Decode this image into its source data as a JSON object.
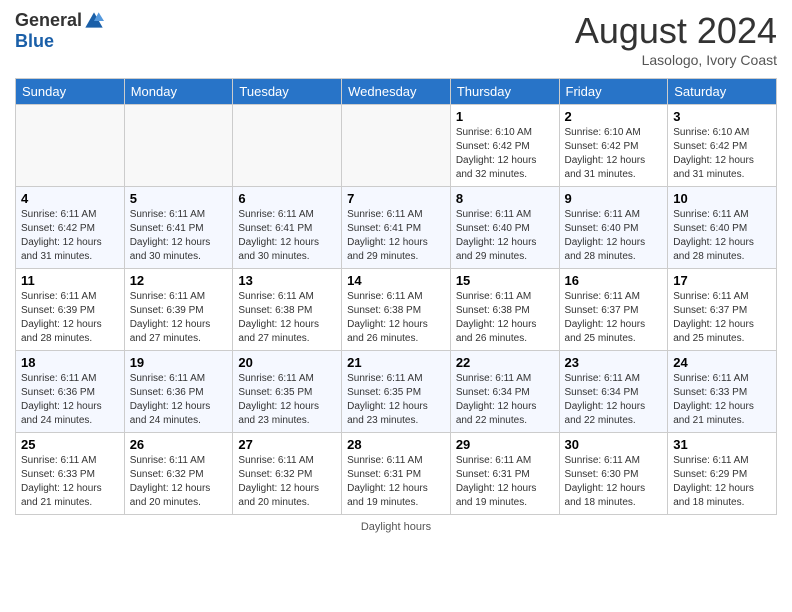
{
  "logo": {
    "general": "General",
    "blue": "Blue"
  },
  "header": {
    "month_year": "August 2024",
    "location": "Lasologo, Ivory Coast"
  },
  "days_of_week": [
    "Sunday",
    "Monday",
    "Tuesday",
    "Wednesday",
    "Thursday",
    "Friday",
    "Saturday"
  ],
  "weeks": [
    [
      {
        "day": "",
        "info": ""
      },
      {
        "day": "",
        "info": ""
      },
      {
        "day": "",
        "info": ""
      },
      {
        "day": "",
        "info": ""
      },
      {
        "day": "1",
        "info": "Sunrise: 6:10 AM\nSunset: 6:42 PM\nDaylight: 12 hours\nand 32 minutes."
      },
      {
        "day": "2",
        "info": "Sunrise: 6:10 AM\nSunset: 6:42 PM\nDaylight: 12 hours\nand 31 minutes."
      },
      {
        "day": "3",
        "info": "Sunrise: 6:10 AM\nSunset: 6:42 PM\nDaylight: 12 hours\nand 31 minutes."
      }
    ],
    [
      {
        "day": "4",
        "info": "Sunrise: 6:11 AM\nSunset: 6:42 PM\nDaylight: 12 hours\nand 31 minutes."
      },
      {
        "day": "5",
        "info": "Sunrise: 6:11 AM\nSunset: 6:41 PM\nDaylight: 12 hours\nand 30 minutes."
      },
      {
        "day": "6",
        "info": "Sunrise: 6:11 AM\nSunset: 6:41 PM\nDaylight: 12 hours\nand 30 minutes."
      },
      {
        "day": "7",
        "info": "Sunrise: 6:11 AM\nSunset: 6:41 PM\nDaylight: 12 hours\nand 29 minutes."
      },
      {
        "day": "8",
        "info": "Sunrise: 6:11 AM\nSunset: 6:40 PM\nDaylight: 12 hours\nand 29 minutes."
      },
      {
        "day": "9",
        "info": "Sunrise: 6:11 AM\nSunset: 6:40 PM\nDaylight: 12 hours\nand 28 minutes."
      },
      {
        "day": "10",
        "info": "Sunrise: 6:11 AM\nSunset: 6:40 PM\nDaylight: 12 hours\nand 28 minutes."
      }
    ],
    [
      {
        "day": "11",
        "info": "Sunrise: 6:11 AM\nSunset: 6:39 PM\nDaylight: 12 hours\nand 28 minutes."
      },
      {
        "day": "12",
        "info": "Sunrise: 6:11 AM\nSunset: 6:39 PM\nDaylight: 12 hours\nand 27 minutes."
      },
      {
        "day": "13",
        "info": "Sunrise: 6:11 AM\nSunset: 6:38 PM\nDaylight: 12 hours\nand 27 minutes."
      },
      {
        "day": "14",
        "info": "Sunrise: 6:11 AM\nSunset: 6:38 PM\nDaylight: 12 hours\nand 26 minutes."
      },
      {
        "day": "15",
        "info": "Sunrise: 6:11 AM\nSunset: 6:38 PM\nDaylight: 12 hours\nand 26 minutes."
      },
      {
        "day": "16",
        "info": "Sunrise: 6:11 AM\nSunset: 6:37 PM\nDaylight: 12 hours\nand 25 minutes."
      },
      {
        "day": "17",
        "info": "Sunrise: 6:11 AM\nSunset: 6:37 PM\nDaylight: 12 hours\nand 25 minutes."
      }
    ],
    [
      {
        "day": "18",
        "info": "Sunrise: 6:11 AM\nSunset: 6:36 PM\nDaylight: 12 hours\nand 24 minutes."
      },
      {
        "day": "19",
        "info": "Sunrise: 6:11 AM\nSunset: 6:36 PM\nDaylight: 12 hours\nand 24 minutes."
      },
      {
        "day": "20",
        "info": "Sunrise: 6:11 AM\nSunset: 6:35 PM\nDaylight: 12 hours\nand 23 minutes."
      },
      {
        "day": "21",
        "info": "Sunrise: 6:11 AM\nSunset: 6:35 PM\nDaylight: 12 hours\nand 23 minutes."
      },
      {
        "day": "22",
        "info": "Sunrise: 6:11 AM\nSunset: 6:34 PM\nDaylight: 12 hours\nand 22 minutes."
      },
      {
        "day": "23",
        "info": "Sunrise: 6:11 AM\nSunset: 6:34 PM\nDaylight: 12 hours\nand 22 minutes."
      },
      {
        "day": "24",
        "info": "Sunrise: 6:11 AM\nSunset: 6:33 PM\nDaylight: 12 hours\nand 21 minutes."
      }
    ],
    [
      {
        "day": "25",
        "info": "Sunrise: 6:11 AM\nSunset: 6:33 PM\nDaylight: 12 hours\nand 21 minutes."
      },
      {
        "day": "26",
        "info": "Sunrise: 6:11 AM\nSunset: 6:32 PM\nDaylight: 12 hours\nand 20 minutes."
      },
      {
        "day": "27",
        "info": "Sunrise: 6:11 AM\nSunset: 6:32 PM\nDaylight: 12 hours\nand 20 minutes."
      },
      {
        "day": "28",
        "info": "Sunrise: 6:11 AM\nSunset: 6:31 PM\nDaylight: 12 hours\nand 19 minutes."
      },
      {
        "day": "29",
        "info": "Sunrise: 6:11 AM\nSunset: 6:31 PM\nDaylight: 12 hours\nand 19 minutes."
      },
      {
        "day": "30",
        "info": "Sunrise: 6:11 AM\nSunset: 6:30 PM\nDaylight: 12 hours\nand 18 minutes."
      },
      {
        "day": "31",
        "info": "Sunrise: 6:11 AM\nSunset: 6:29 PM\nDaylight: 12 hours\nand 18 minutes."
      }
    ]
  ],
  "footer": {
    "text": "Daylight hours",
    "link": "https://www.generalblue.com"
  }
}
